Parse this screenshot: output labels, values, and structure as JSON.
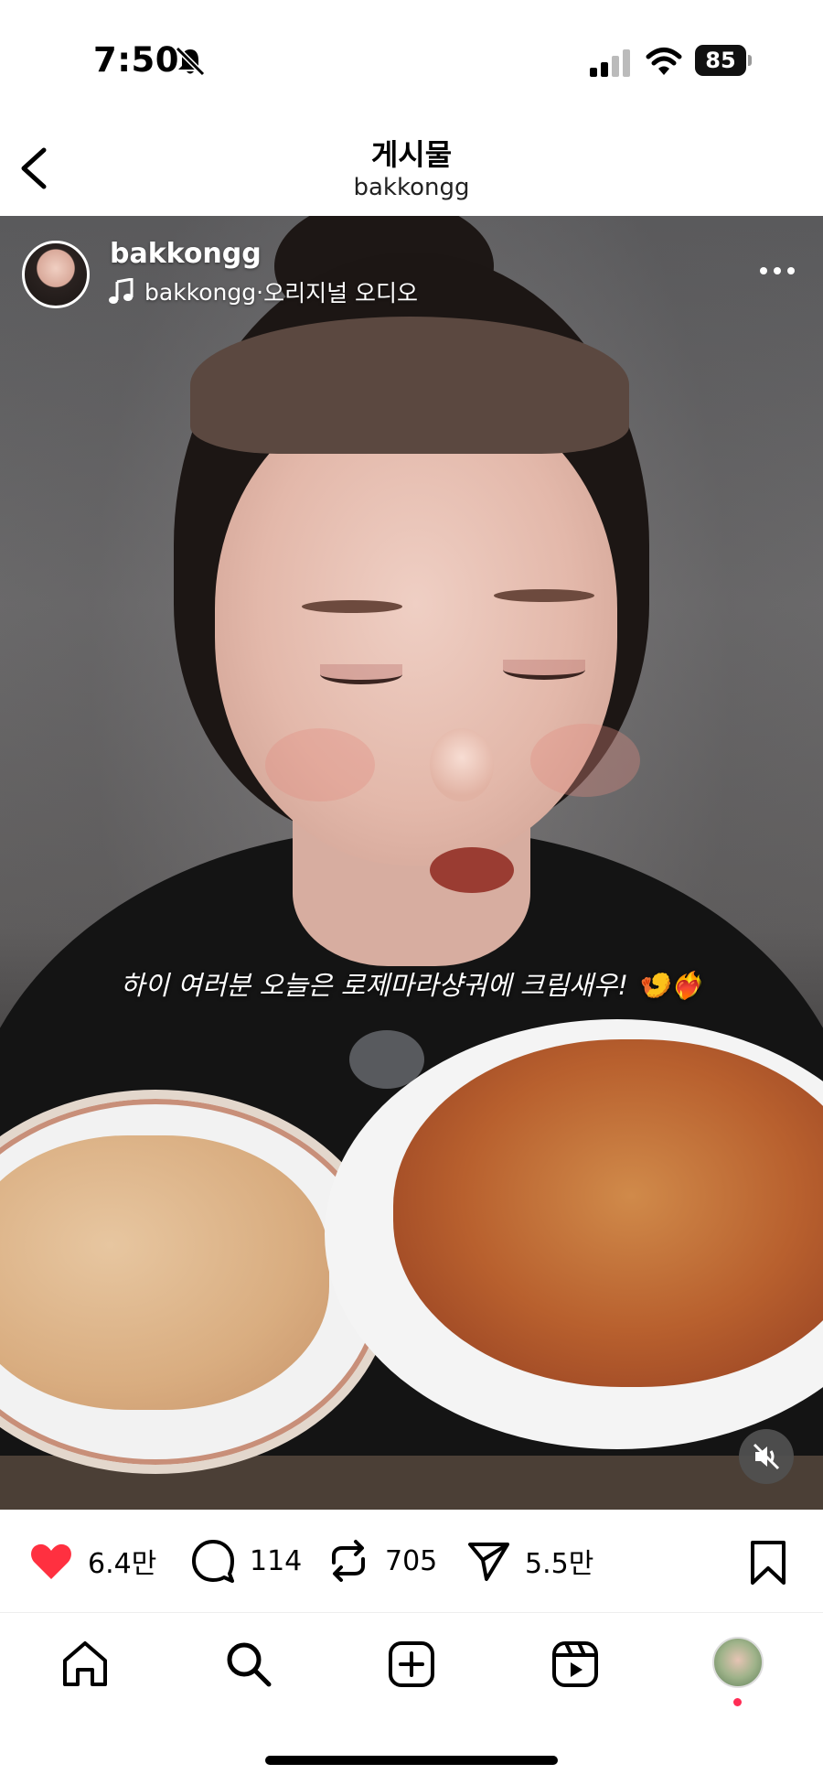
{
  "status_bar": {
    "time": "7:50",
    "battery": "85"
  },
  "header": {
    "title": "게시물",
    "subtitle": "bakkongg"
  },
  "post": {
    "username": "bakkongg",
    "audio_user": "bakkongg",
    "audio_separator": " · ",
    "audio_label": "오리지널 오디오",
    "caption": "하이 여러분 오늘은 로제마라샹궈에 크림새우! 🍤❤️‍🔥"
  },
  "actions": {
    "likes": "6.4만",
    "comments": "114",
    "reposts": "705",
    "shares": "5.5만"
  },
  "colors": {
    "like": "#ff3040",
    "notification_dot": "#ff2d55"
  },
  "icons": {
    "status": [
      "bell-slash-icon",
      "cellular-signal-icon",
      "wifi-icon",
      "battery-icon"
    ],
    "tabs": [
      "home-icon",
      "search-icon",
      "create-icon",
      "reels-icon",
      "profile-avatar"
    ]
  }
}
